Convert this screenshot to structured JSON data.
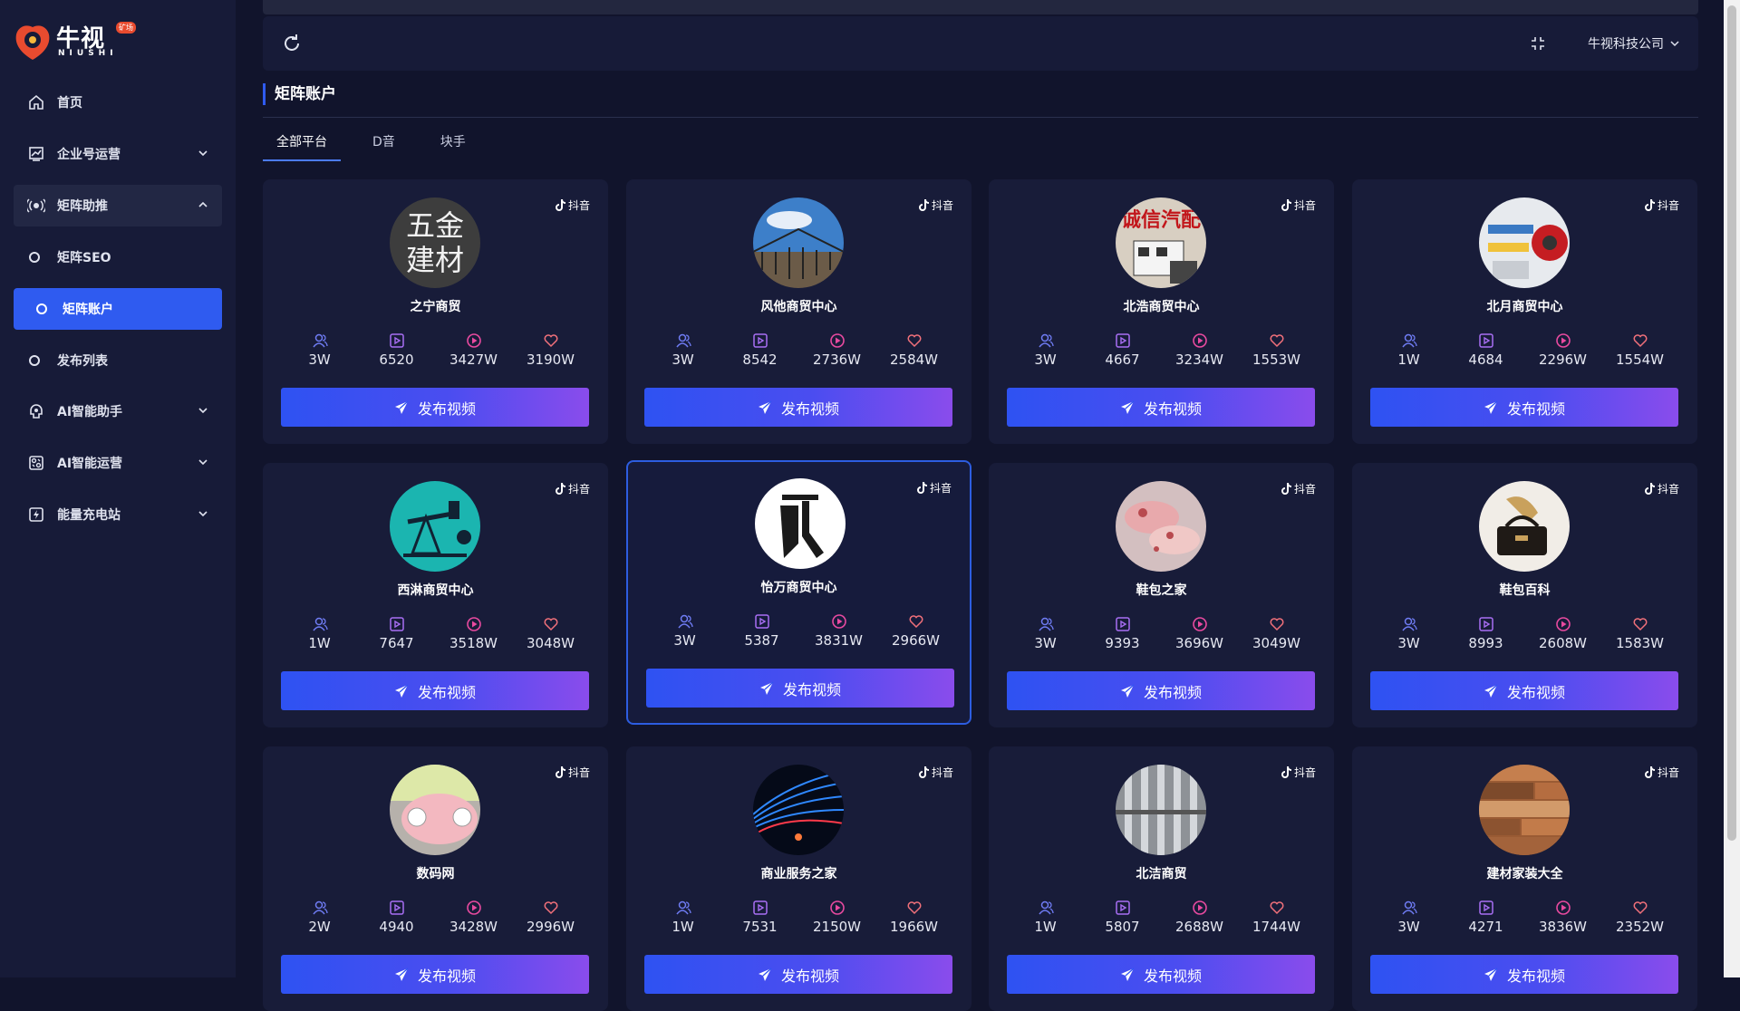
{
  "app": {
    "logo_cn": "牛视",
    "logo_en": "NIUSHI",
    "logo_badge": "矿场"
  },
  "sidebar": {
    "items": [
      {
        "label": "首页",
        "icon": "home-icon"
      },
      {
        "label": "企业号运营",
        "icon": "chart-icon",
        "expandable": true
      },
      {
        "label": "矩阵助推",
        "icon": "broadcast-icon",
        "expandable": true,
        "expanded": true
      },
      {
        "label": "矩阵SEO",
        "icon": "circle-icon",
        "sub": true
      },
      {
        "label": "矩阵账户",
        "icon": "circle-icon",
        "sub": true,
        "active": true
      },
      {
        "label": "发布列表",
        "icon": "circle-icon",
        "sub": true
      },
      {
        "label": "AI智能助手",
        "icon": "ai-assistant-icon",
        "expandable": true
      },
      {
        "label": "AI智能运营",
        "icon": "ai-operations-icon",
        "expandable": true
      },
      {
        "label": "能量充电站",
        "icon": "energy-icon",
        "expandable": true
      }
    ]
  },
  "header": {
    "company": "牛视科技公司"
  },
  "page": {
    "title": "矩阵账户",
    "tabs": [
      {
        "label": "全部平台",
        "active": true
      },
      {
        "label": "D音"
      },
      {
        "label": "块手"
      }
    ]
  },
  "colors": {
    "accent": "#2f5bf0",
    "button_gradient_start": "#2e52f2",
    "button_gradient_end": "#8a4cec",
    "bg": "#11142c",
    "card_bg": "#181c39"
  },
  "cards": [
    {
      "name": "之宁商贸",
      "platform": "抖音",
      "fans": "3W",
      "videos": "6520",
      "plays": "3427W",
      "likes": "3190W",
      "button": "发布视频",
      "avatar_text": "五金建材"
    },
    {
      "name": "风他商贸中心",
      "platform": "抖音",
      "fans": "3W",
      "videos": "8542",
      "plays": "2736W",
      "likes": "2584W",
      "button": "发布视频"
    },
    {
      "name": "北浩商贸中心",
      "platform": "抖音",
      "fans": "3W",
      "videos": "4667",
      "plays": "3234W",
      "likes": "1553W",
      "button": "发布视频",
      "avatar_text": "诚信汽配"
    },
    {
      "name": "北月商贸中心",
      "platform": "抖音",
      "fans": "1W",
      "videos": "4684",
      "plays": "2296W",
      "likes": "1554W",
      "button": "发布视频"
    },
    {
      "name": "西淋商贸中心",
      "platform": "抖音",
      "fans": "1W",
      "videos": "7647",
      "plays": "3518W",
      "likes": "3048W",
      "button": "发布视频"
    },
    {
      "name": "怡万商贸中心",
      "platform": "抖音",
      "fans": "3W",
      "videos": "5387",
      "plays": "3831W",
      "likes": "2966W",
      "button": "发布视频"
    },
    {
      "name": "鞋包之家",
      "platform": "抖音",
      "fans": "3W",
      "videos": "9393",
      "plays": "3696W",
      "likes": "3049W",
      "button": "发布视频"
    },
    {
      "name": "鞋包百科",
      "platform": "抖音",
      "fans": "3W",
      "videos": "8993",
      "plays": "2608W",
      "likes": "1583W",
      "button": "发布视频"
    },
    {
      "name": "数码网",
      "platform": "抖音",
      "fans": "2W",
      "videos": "4940",
      "plays": "3428W",
      "likes": "2996W",
      "button": "发布视频"
    },
    {
      "name": "商业服务之家",
      "platform": "抖音",
      "fans": "1W",
      "videos": "7531",
      "plays": "2150W",
      "likes": "1966W",
      "button": "发布视频"
    },
    {
      "name": "北洁商贸",
      "platform": "抖音",
      "fans": "1W",
      "videos": "5807",
      "plays": "2688W",
      "likes": "1744W",
      "button": "发布视频"
    },
    {
      "name": "建材家装大全",
      "platform": "抖音",
      "fans": "3W",
      "videos": "4271",
      "plays": "3836W",
      "likes": "2352W",
      "button": "发布视频"
    }
  ]
}
